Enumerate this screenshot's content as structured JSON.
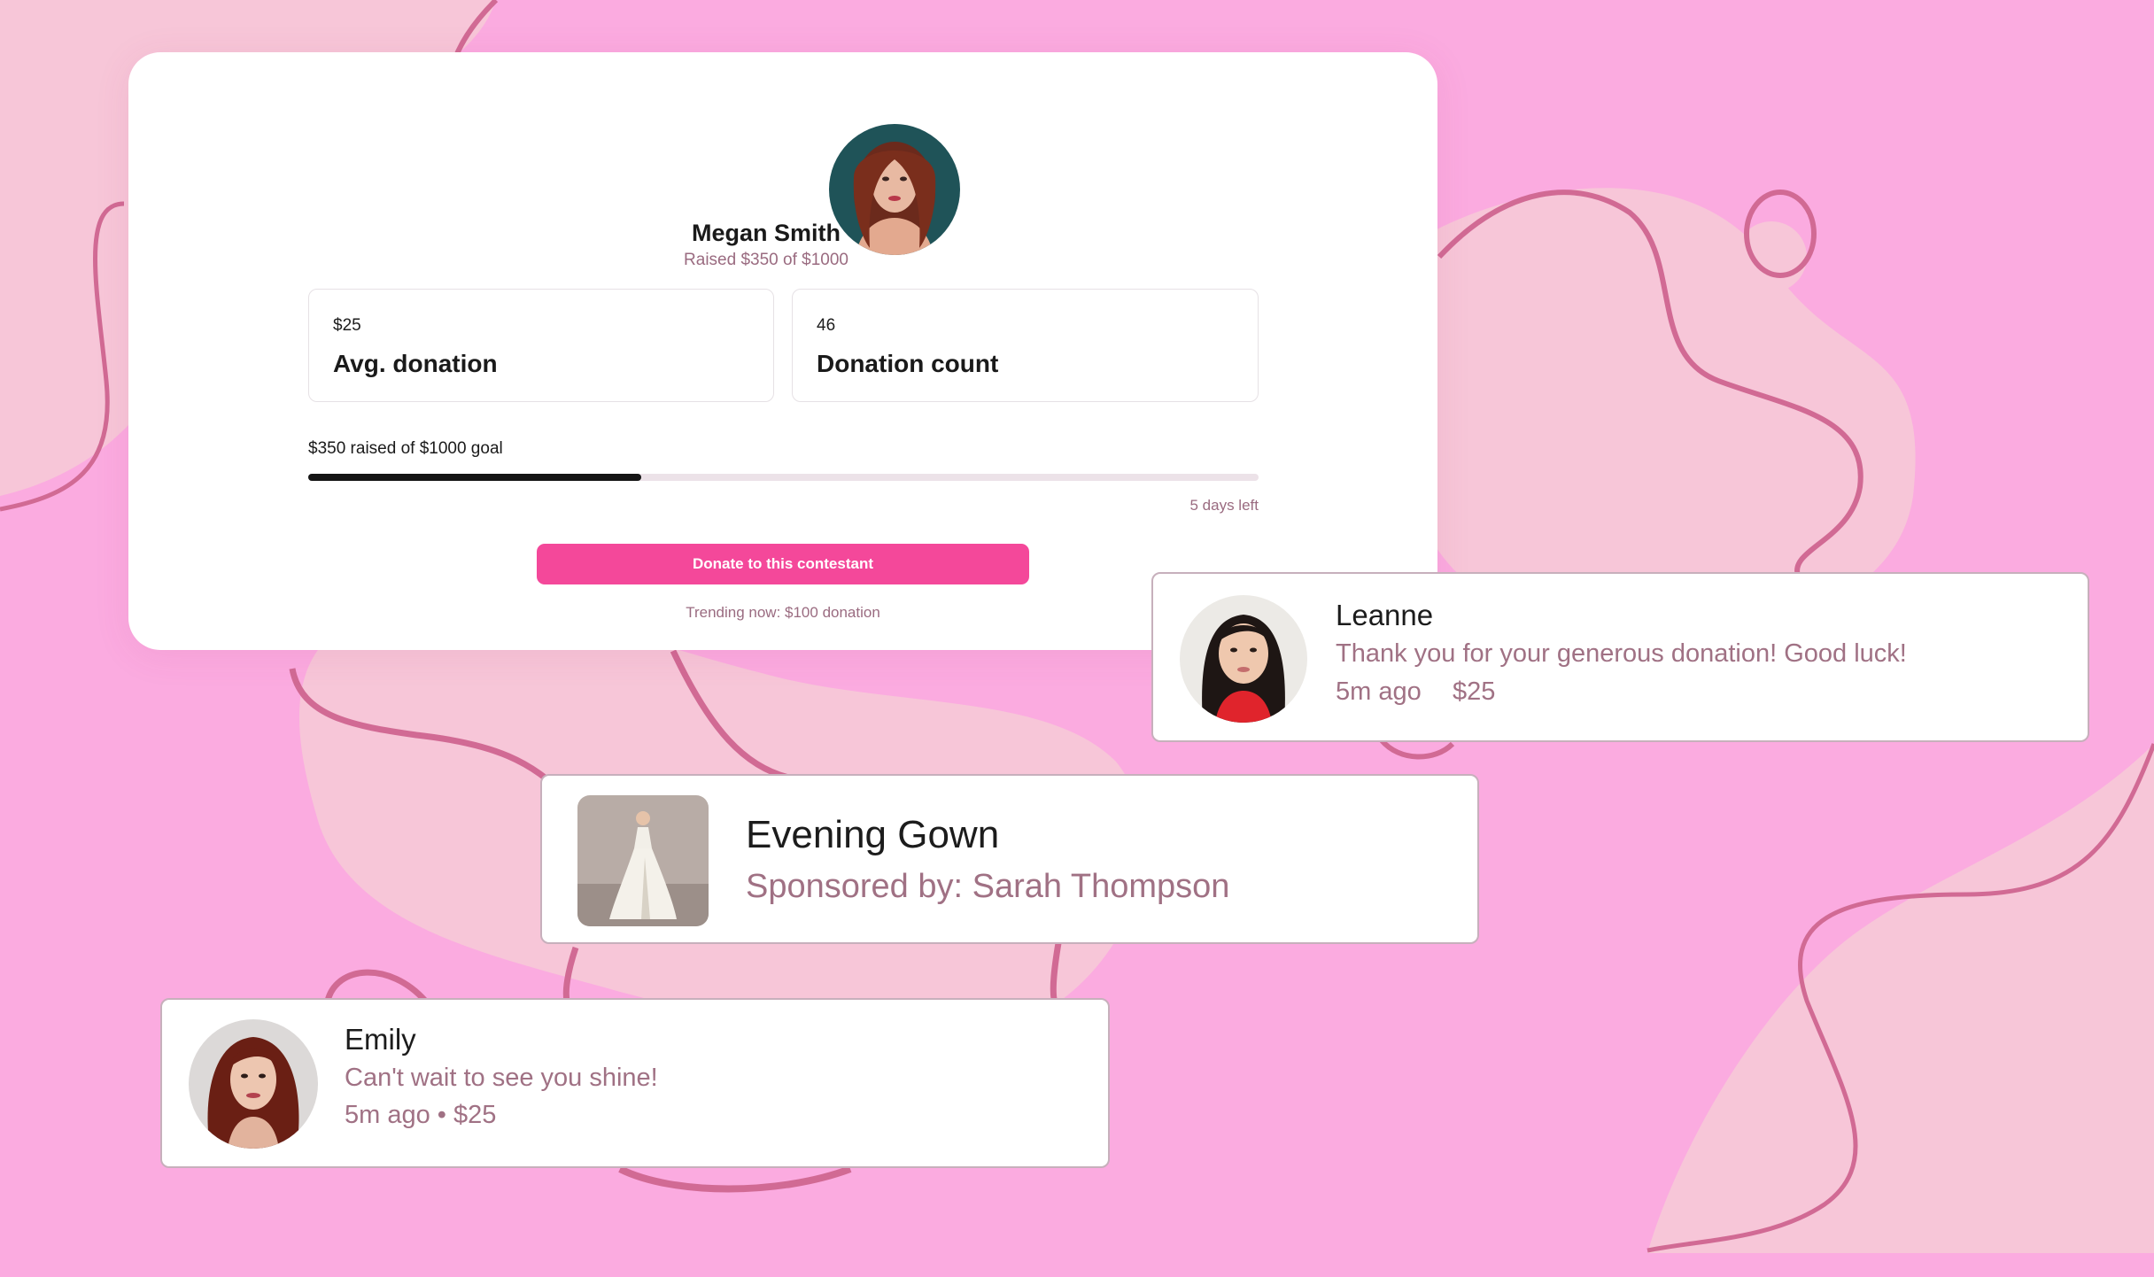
{
  "colors": {
    "background": "#fbabe0",
    "blob": "#f7c6d8",
    "curve": "#d16a94",
    "accent": "#f4489a",
    "muted_text": "#9a6b80",
    "progress_fill": "#151515",
    "progress_track": "#ece2e8"
  },
  "contestant": {
    "name": "Megan Smith",
    "raised_text": "Raised $350 of $1000",
    "avatar_icon": "contestant-avatar"
  },
  "stats": [
    {
      "value": "$25",
      "label": "Avg. donation"
    },
    {
      "value": "46",
      "label": "Donation count"
    }
  ],
  "progress": {
    "label": "$350 raised of $1000 goal",
    "fraction": 0.35,
    "days_left": "5 days left"
  },
  "donate_button": {
    "label": "Donate to this contestant"
  },
  "trending": "Trending now: $100 donation",
  "messages": {
    "leanne": {
      "name": "Leanne",
      "text": "Thank you for your generous donation! Good luck!",
      "time": "5m ago",
      "amount": "$25"
    },
    "gown": {
      "title": "Evening Gown",
      "sponsor": "Sponsored by: Sarah Thompson"
    },
    "emily": {
      "name": "Emily",
      "text": "Can't wait to see you shine!",
      "meta": "5m ago • $25"
    }
  }
}
